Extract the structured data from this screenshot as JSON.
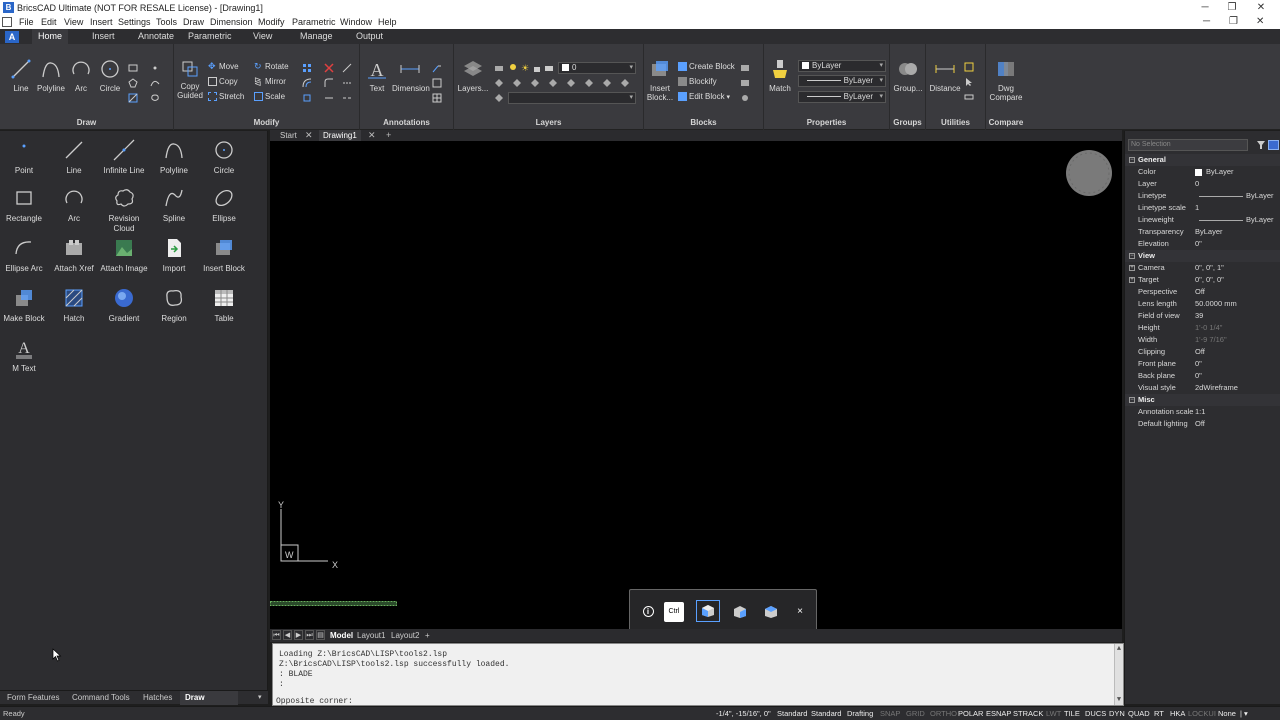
{
  "window": {
    "title": "BricsCAD Ultimate (NOT FOR RESALE License) - [Drawing1]",
    "app_initial": "B"
  },
  "menubar": {
    "items": [
      "File",
      "Edit",
      "View",
      "Insert",
      "Settings",
      "Tools",
      "Draw",
      "Dimension",
      "Modify",
      "Parametric",
      "Window",
      "Help"
    ]
  },
  "ribbon": {
    "tabs": [
      "Home",
      "Insert",
      "Annotate",
      "Parametric",
      "View",
      "Manage",
      "Output"
    ],
    "active_tab": "Home",
    "groups": {
      "draw": {
        "label": "Draw",
        "buttons": [
          "Line",
          "Polyline",
          "Arc",
          "Circle"
        ]
      },
      "modify": {
        "label": "Modify",
        "copy_guided": "Copy Guided",
        "small": [
          "Move",
          "Copy",
          "Stretch",
          "Rotate",
          "Mirror",
          "Scale"
        ]
      },
      "annotations": {
        "label": "Annotations",
        "buttons": [
          "Text",
          "Dimension"
        ]
      },
      "layers": {
        "label": "Layers",
        "button": "Layers...",
        "current_layer": "0"
      },
      "blocks": {
        "label": "Blocks",
        "insert": "Insert Block...",
        "small": [
          "Create Block",
          "Blockify",
          "Edit Block"
        ]
      },
      "properties": {
        "label": "Properties",
        "match": "Match",
        "color": "ByLayer",
        "linetype": "ByLayer",
        "lineweight": "ByLayer"
      },
      "groups": {
        "label": "Groups",
        "button": "Group..."
      },
      "utilities": {
        "label": "Utilities",
        "button": "Distance"
      },
      "compare": {
        "label": "Compare",
        "button": "Dwg Compare"
      }
    }
  },
  "tool_panel": {
    "tools": [
      [
        "Point",
        "Line",
        "Infinite Line",
        "Polyline",
        "Circle"
      ],
      [
        "Rectangle",
        "Arc",
        "Revision Cloud",
        "Spline",
        "Ellipse"
      ],
      [
        "Ellipse Arc",
        "Attach Xref",
        "Attach Image",
        "Import",
        "Insert Block"
      ],
      [
        "Make Block",
        "Hatch",
        "Gradient",
        "Region",
        "Table"
      ],
      [
        "M Text"
      ]
    ],
    "bottom_tabs": [
      "Form Features",
      "Command Tools",
      "Hatches",
      "Draw"
    ],
    "active_bottom_tab": "Draw"
  },
  "document_tabs": {
    "tabs": [
      "Start",
      "Drawing1"
    ],
    "active": "Drawing1",
    "add": "+"
  },
  "canvas": {
    "ucs_y": "Y",
    "ucs_x": "X",
    "ucs_w": "W",
    "quad_toolbar": {
      "info": "i",
      "ctrl": "Ctrl",
      "close": "×"
    }
  },
  "layout_tabs": {
    "tabs": [
      "Model",
      "Layout1",
      "Layout2"
    ],
    "active": "Model",
    "add": "+"
  },
  "command_line": {
    "lines": [
      "Loading Z:\\BricsCAD\\LISP\\tools2.lsp",
      "Z:\\BricsCAD\\LISP\\tools2.lsp successfully loaded.",
      ": BLADE",
      ":"
    ],
    "prompt": "Opposite corner:"
  },
  "properties_panel": {
    "selection": "No Selection",
    "sections": [
      {
        "name": "General",
        "rows": [
          [
            "Color",
            "ByLayer"
          ],
          [
            "Layer",
            "0"
          ],
          [
            "Linetype",
            "ByLayer"
          ],
          [
            "Linetype scale",
            "1"
          ],
          [
            "Lineweight",
            "ByLayer"
          ],
          [
            "Transparency",
            "ByLayer"
          ],
          [
            "Elevation",
            "0\""
          ]
        ]
      },
      {
        "name": "View",
        "rows": [
          [
            "Camera",
            "0\", 0\", 1\""
          ],
          [
            "Target",
            "0\", 0\", 0\""
          ],
          [
            "Perspective",
            "Off"
          ],
          [
            "Lens length",
            "50.0000 mm"
          ],
          [
            "Field of view",
            "39"
          ],
          [
            "Height",
            "1'-0 1/4\""
          ],
          [
            "Width",
            "1'-9 7/16\""
          ],
          [
            "Clipping",
            "Off"
          ],
          [
            "Front plane",
            "0\""
          ],
          [
            "Back plane",
            "0\""
          ],
          [
            "Visual style",
            "2dWireframe"
          ]
        ]
      },
      {
        "name": "Misc",
        "rows": [
          [
            "Annotation scale",
            "1:1"
          ],
          [
            "Default lighting",
            "Off"
          ]
        ]
      }
    ]
  },
  "statusbar": {
    "ready": "Ready",
    "coords": "-1/4\", -15/16\", 0\"",
    "items": [
      "Standard",
      "Standard",
      "Drafting",
      "SNAP",
      "GRID",
      "ORTHO",
      "POLAR",
      "ESNAP",
      "STRACK",
      "LWT",
      "TILE",
      "DUCS",
      "DYN",
      "QUAD",
      "RT",
      "HKA",
      "LOCKUI",
      "None"
    ],
    "on_items": [
      "Standard",
      "Drafting",
      "POLAR",
      "ESNAP",
      "STRACK",
      "TILE",
      "DUCS",
      "DYN",
      "QUAD",
      "RT",
      "HKA",
      "None"
    ]
  },
  "colors": {
    "accent": "#2a66c8",
    "canvas": "#000000",
    "panel": "#2d2d30",
    "ribbon": "#3a3a3e"
  }
}
